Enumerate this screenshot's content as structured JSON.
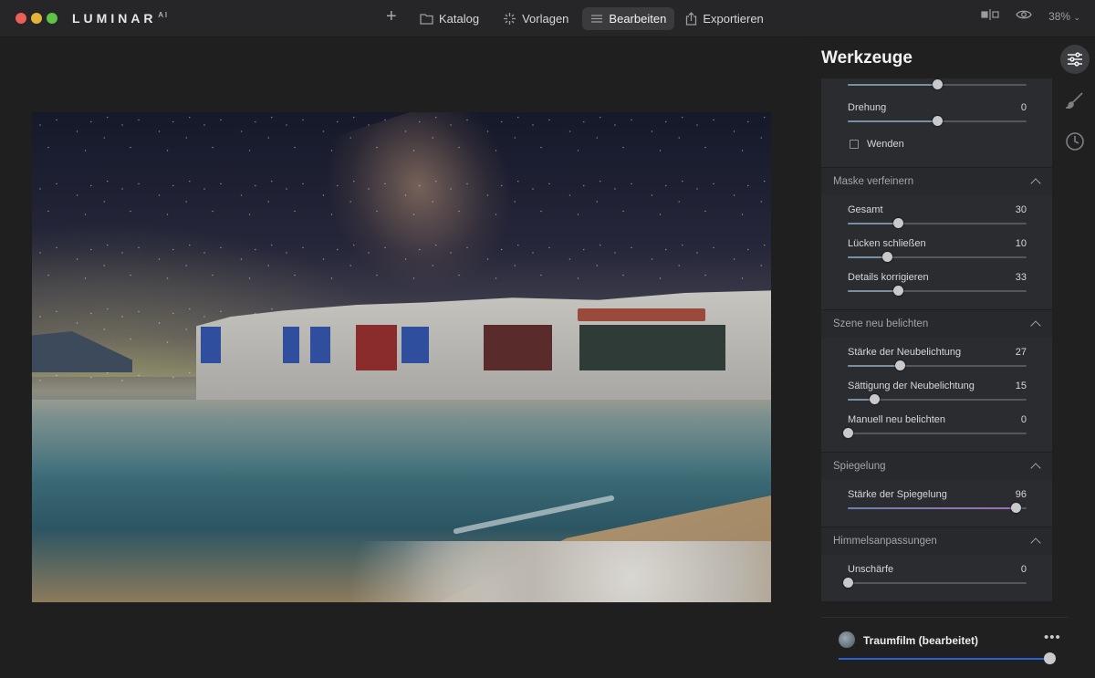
{
  "app": {
    "logo": "LUMINAR",
    "logo_sup": "AI"
  },
  "nav": {
    "plus": "+",
    "items": [
      {
        "label": "Katalog",
        "icon": "folder-icon"
      },
      {
        "label": "Vorlagen",
        "icon": "sparkle-icon"
      },
      {
        "label": "Bearbeiten",
        "icon": "sliders-icon",
        "active": true
      },
      {
        "label": "Exportieren",
        "icon": "share-icon"
      }
    ],
    "zoom": "38%"
  },
  "panel": {
    "title": "Werkzeuge",
    "top": {
      "rotation_label": "Drehung",
      "rotation_value": "0",
      "rotation_level": 0.5,
      "flip_label": "Wenden",
      "prev_level": 0.5
    },
    "sections": [
      {
        "title": "Maske verfeinern",
        "sliders": [
          {
            "label": "Gesamt",
            "value": "30",
            "level": 0.28
          },
          {
            "label": "Lücken schließen",
            "value": "10",
            "level": 0.22
          },
          {
            "label": "Details korrigieren",
            "value": "33",
            "level": 0.28
          }
        ]
      },
      {
        "title": "Szene neu belichten",
        "sliders": [
          {
            "label": "Stärke der Neubelichtung",
            "value": "27",
            "level": 0.29
          },
          {
            "label": "Sättigung der Neubelichtung",
            "value": "15",
            "level": 0.15
          },
          {
            "label": "Manuell neu belichten",
            "value": "0",
            "level": 0.0
          }
        ]
      },
      {
        "title": "Spiegelung",
        "sliders": [
          {
            "label": "Stärke der Spiegelung",
            "value": "96",
            "level": 0.94
          }
        ]
      },
      {
        "title": "Himmelsanpassungen",
        "sliders": [
          {
            "label": "Unschärfe",
            "value": "0",
            "level": 0.0
          }
        ]
      }
    ]
  },
  "preset": {
    "name": "Traumfilm (bearbeitet)",
    "amount_level": 1.0
  }
}
